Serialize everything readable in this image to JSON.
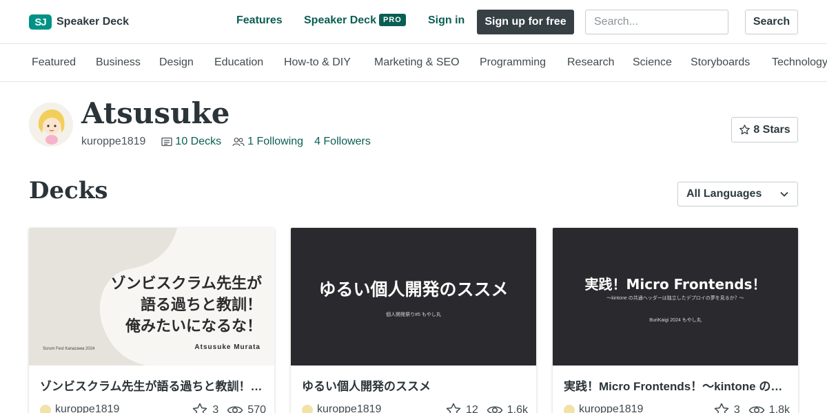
{
  "header": {
    "logo_mark": "SJ",
    "logo_text": "Speaker Deck",
    "features": "Features",
    "speakerdeck_pro": "Speaker Deck",
    "pro_badge": "PRO",
    "sign_in": "Sign in",
    "sign_up": "Sign up for free",
    "search_placeholder": "Search...",
    "search_button": "Search"
  },
  "categories": [
    "Featured",
    "Business",
    "Design",
    "Education",
    "How-to & DIY",
    "Marketing & SEO",
    "Programming",
    "Research",
    "Science",
    "Storyboards",
    "Technology"
  ],
  "profile": {
    "name": "Atsusuke",
    "username": "kuroppe1819",
    "decks": "10 Decks",
    "following": "1 Following",
    "followers": "4 Followers",
    "stars": "8 Stars"
  },
  "decks_section": {
    "title": "Decks",
    "language_filter": "All Languages"
  },
  "decks": [
    {
      "thumb_lines": [
        "ゾンビスクラム先生が",
        "語る過ちと教訓！",
        "俺みたいになるな！"
      ],
      "thumb_author": "Atsusuke Murata",
      "thumb_event": "Scrum Fest Kanazawa 2024",
      "title": "ゾンビスクラム先生が語る過ちと教訓！俺みたいになるな！",
      "author": "kuroppe1819",
      "stars": "3",
      "views": "570"
    },
    {
      "thumb_title": "ゆるい個人開発のススメ",
      "thumb_sub": "個人開発祭り#5 もやし丸",
      "title": "ゆるい個人開発のススメ",
      "author": "kuroppe1819",
      "stars": "12",
      "views": "1.6k"
    },
    {
      "thumb_title": "実践！Micro Frontends！",
      "thumb_sub": "～kintone の共通ヘッダーは独立したデプロイの夢を見るか？～",
      "thumb_event": "BuriKaigi 2024 もやし丸",
      "title": "実践！Micro Frontends！～kintone の共通ヘッダーは独立したデプロイの夢を見るか？～",
      "author": "kuroppe1819",
      "stars": "3",
      "views": "1.8k"
    }
  ],
  "colors": {
    "brand": "#009287",
    "link": "#0b5e53",
    "dark_button": "#364045",
    "thumb_dark": "#2a2a2e"
  }
}
